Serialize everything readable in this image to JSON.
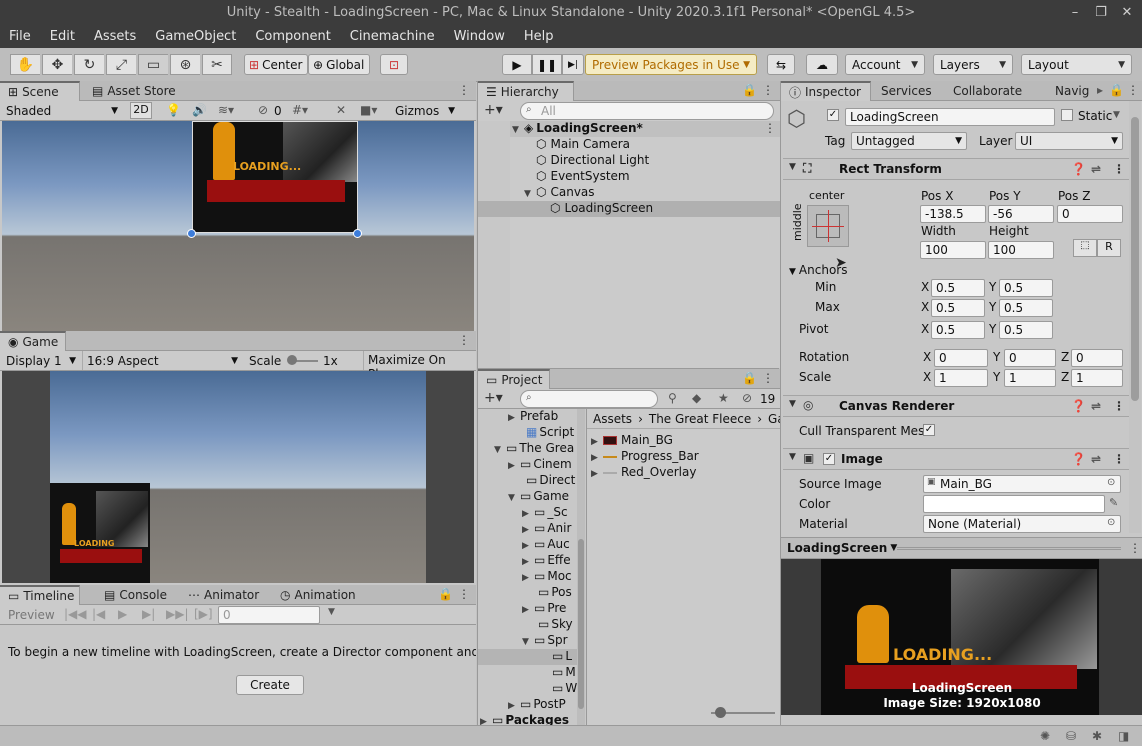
{
  "window": {
    "title": "Unity - Stealth - LoadingScreen - PC, Mac & Linux Standalone - Unity 2020.3.1f1 Personal* <OpenGL 4.5>"
  },
  "menu": [
    "File",
    "Edit",
    "Assets",
    "GameObject",
    "Component",
    "Cinemachine",
    "Window",
    "Help"
  ],
  "toolbar": {
    "center": "Center",
    "global": "Global",
    "preview_packages": "Preview Packages in Use",
    "account": "Account",
    "layers": "Layers",
    "layout": "Layout"
  },
  "scene": {
    "tab": "Scene",
    "asset_store_tab": "Asset Store",
    "shading": "Shaded",
    "mode_2d": "2D",
    "hidden_count": "0",
    "gizmos": "Gizmos",
    "loading_text": "LOADING..."
  },
  "game": {
    "tab": "Game",
    "display": "Display 1",
    "aspect": "16:9 Aspect",
    "scale_label": "Scale",
    "scale_value": "1x",
    "maximize": "Maximize On Play",
    "loading_text": "LOADING"
  },
  "timeline": {
    "tabs": [
      "Timeline",
      "Console",
      "Animator",
      "Animation"
    ],
    "preview": "Preview",
    "frame": "0",
    "message": "To begin a new timeline with LoadingScreen, create a Director component and a Tir",
    "create": "Create"
  },
  "hierarchy": {
    "tab": "Hierarchy",
    "search_placeholder": "All",
    "items": [
      {
        "label": "LoadingScreen*"
      },
      {
        "label": "Main Camera"
      },
      {
        "label": "Directional Light"
      },
      {
        "label": "EventSystem"
      },
      {
        "label": "Canvas"
      },
      {
        "label": "LoadingScreen"
      }
    ]
  },
  "project": {
    "tab": "Project",
    "hidden_count": "19",
    "tree": [
      "Prefab",
      "Script",
      "The Grea",
      "Cinem",
      "Direct",
      "Game",
      "_Sc",
      "Anir",
      "Auc",
      "Effe",
      "Moc",
      "Pos",
      "Pre",
      "Sky",
      "Spr",
      "L",
      "M",
      "W",
      "PostP",
      "Packages"
    ],
    "breadcrumb": [
      "Assets",
      "The Great Fleece",
      "Ga"
    ],
    "assets": [
      "Main_BG",
      "Progress_Bar",
      "Red_Overlay"
    ]
  },
  "inspector": {
    "tabs": [
      "Inspector",
      "Services",
      "Collaborate",
      "Navig"
    ],
    "name": "LoadingScreen",
    "static": "Static",
    "tag_label": "Tag",
    "tag": "Untagged",
    "layer_label": "Layer",
    "layer": "UI",
    "rect": {
      "title": "Rect Transform",
      "anchor_h": "center",
      "anchor_v": "middle",
      "pos_x_label": "Pos X",
      "pos_y_label": "Pos Y",
      "pos_z_label": "Pos Z",
      "pos_x": "-138.5",
      "pos_y": "-56",
      "pos_z": "0",
      "width_label": "Width",
      "height_label": "Height",
      "width": "100",
      "height": "100",
      "r": "R",
      "anchors_label": "Anchors",
      "min_label": "Min",
      "max_label": "Max",
      "min_x": "0.5",
      "min_y": "0.5",
      "max_x": "0.5",
      "max_y": "0.5",
      "pivot_label": "Pivot",
      "pivot_x": "0.5",
      "pivot_y": "0.5",
      "rotation_label": "Rotation",
      "rot_x": "0",
      "rot_y": "0",
      "rot_z": "0",
      "scale_label": "Scale",
      "scale_x": "1",
      "scale_y": "1",
      "scale_z": "1"
    },
    "canvas_renderer": {
      "title": "Canvas Renderer",
      "cull": "Cull Transparent Mes"
    },
    "image": {
      "title": "Image",
      "source_label": "Source Image",
      "source": "Main_BG",
      "color_label": "Color",
      "material_label": "Material",
      "material": "None (Material)"
    },
    "preview": {
      "object": "LoadingScreen",
      "loading_text": "LOADING...",
      "caption_name": "LoadingScreen",
      "caption_size": "Image Size: 1920x1080"
    }
  }
}
